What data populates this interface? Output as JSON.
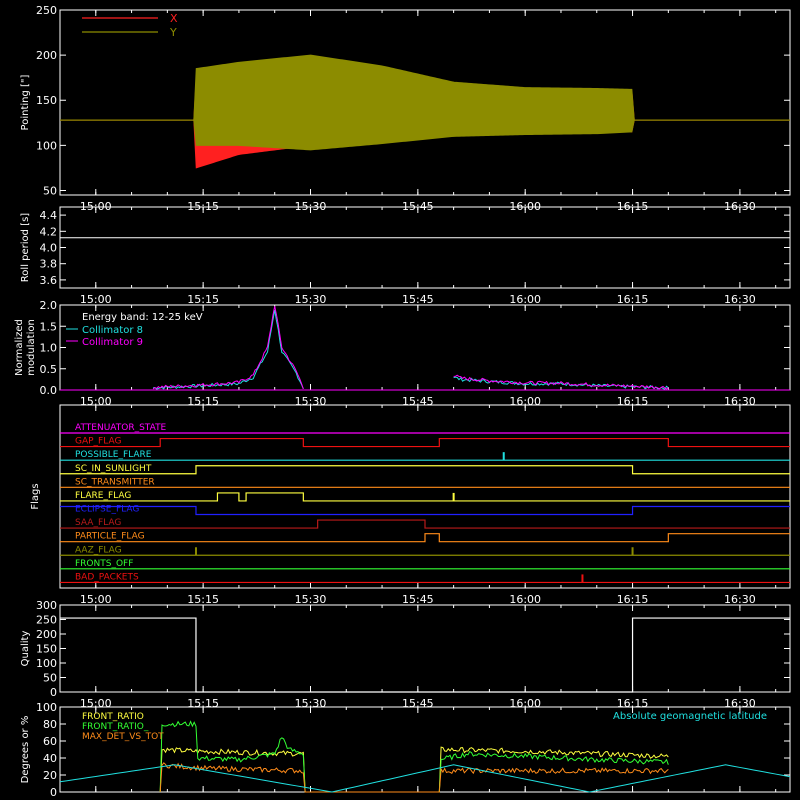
{
  "colors": {
    "background": "#000000",
    "axes": "#ffffff",
    "x": "#ff2020",
    "y": "#8c8c00",
    "cyan": "#20e0e0",
    "magenta": "#ff00ff",
    "green": "#22dd22",
    "yellow": "#ffff40",
    "orange": "#ff8c1a",
    "lime": "#33ff33",
    "blue": "#2020ff",
    "red": "#ee1111",
    "darkred": "#b81a1a",
    "olive": "#8c8c00"
  },
  "time_axis": {
    "range": [
      "14:55",
      "16:37"
    ],
    "ticks": [
      "15:00",
      "15:15",
      "15:30",
      "15:45",
      "16:00",
      "16:15",
      "16:30"
    ]
  },
  "chart_data": [
    {
      "id": "pointing",
      "type": "area",
      "ylabel": "Pointing [\"]",
      "ylim": [
        45,
        250
      ],
      "yticks": [
        50,
        100,
        150,
        200,
        250
      ],
      "baseline": 128,
      "series": [
        {
          "name": "X",
          "color": "#ff2020",
          "x": [
            "14:55",
            "15:14",
            "15:14",
            "15:20",
            "15:30",
            "15:40",
            "15:50",
            "16:00",
            "16:10",
            "16:15",
            "16:15",
            "16:37"
          ],
          "upper": [
            128,
            128,
            175,
            178,
            170,
            162,
            158,
            157,
            159,
            160,
            128,
            128
          ],
          "lower": [
            128,
            128,
            75,
            90,
            100,
            108,
            112,
            115,
            115,
            115,
            128,
            128
          ]
        },
        {
          "name": "Y",
          "color": "#8c8c00",
          "x": [
            "14:55",
            "15:14",
            "15:14",
            "15:20",
            "15:30",
            "15:40",
            "15:50",
            "16:00",
            "16:10",
            "16:15",
            "16:15",
            "16:37"
          ],
          "upper": [
            128,
            128,
            185,
            192,
            200,
            188,
            170,
            164,
            163,
            162,
            128,
            128
          ],
          "lower": [
            128,
            128,
            100,
            100,
            95,
            102,
            110,
            112,
            113,
            115,
            128,
            128
          ]
        }
      ]
    },
    {
      "id": "roll",
      "type": "line",
      "ylabel": "Roll period [s]",
      "ylim": [
        3.5,
        4.5
      ],
      "yticks": [
        3.6,
        3.8,
        4.0,
        4.2,
        4.4
      ],
      "series": [
        {
          "name": "",
          "x": [
            "14:55",
            "16:37"
          ],
          "y": [
            4.12,
            4.12
          ]
        }
      ]
    },
    {
      "id": "modulation",
      "type": "line",
      "ylabel": "Normalized modulation",
      "ylim": [
        0,
        2.0
      ],
      "yticks": [
        0.0,
        0.5,
        1.0,
        1.5,
        2.0
      ],
      "annotation": "Energy band: 12-25 keV",
      "series": [
        {
          "name": "Collimator 8",
          "color": "#20e0e0",
          "x": [
            "15:08",
            "15:15",
            "15:17",
            "15:20",
            "15:22",
            "15:24",
            "15:25",
            "15:26",
            "15:28",
            "15:29",
            "15:50",
            "15:51",
            "15:55",
            "16:00",
            "16:05",
            "16:10",
            "16:20"
          ],
          "y": [
            0.05,
            0.1,
            0.12,
            0.15,
            0.3,
            0.9,
            1.9,
            0.9,
            0.4,
            0.05,
            0.3,
            0.25,
            0.2,
            0.15,
            0.15,
            0.1,
            0.05
          ]
        },
        {
          "name": "Collimator 9",
          "color": "#ff00ff",
          "x": [
            "15:08",
            "15:15",
            "15:17",
            "15:20",
            "15:22",
            "15:24",
            "15:25",
            "15:26",
            "15:28",
            "15:29",
            "15:50",
            "15:51",
            "15:55",
            "16:00",
            "16:05",
            "16:10",
            "16:20"
          ],
          "y": [
            0.06,
            0.12,
            0.14,
            0.18,
            0.35,
            1.0,
            2.0,
            1.0,
            0.45,
            0.06,
            0.35,
            0.28,
            0.22,
            0.17,
            0.16,
            0.12,
            0.06
          ]
        }
      ]
    },
    {
      "id": "flags",
      "type": "line",
      "ylabel": "Flags",
      "series": [
        {
          "name": "ATTENUATOR_STATE",
          "color": "#ff00ff",
          "initial": 0,
          "transitions": []
        },
        {
          "name": "GAP_FLAG",
          "color": "#ee1111",
          "initial": 0,
          "transitions": [
            [
              "15:09",
              1
            ],
            [
              "15:29",
              0
            ],
            [
              "15:48",
              1
            ],
            [
              "16:20",
              0
            ]
          ]
        },
        {
          "name": "POSSIBLE_FLARE",
          "color": "#20e0e0",
          "initial": 0,
          "transitions": [],
          "spikes": [
            "15:57"
          ]
        },
        {
          "name": "SC_IN_SUNLIGHT",
          "color": "#ffff40",
          "initial": 0,
          "transitions": [
            [
              "15:14",
              1
            ],
            [
              "16:15",
              0
            ]
          ]
        },
        {
          "name": "SC_TRANSMITTER",
          "color": "#ff8c1a",
          "initial": 0,
          "transitions": []
        },
        {
          "name": "FLARE_FLAG",
          "color": "#ffff40",
          "initial": 0,
          "transitions": [
            [
              "15:17",
              1
            ],
            [
              "15:20",
              0
            ],
            [
              "15:21",
              1
            ],
            [
              "15:29",
              0
            ]
          ],
          "spikes": [
            "15:50"
          ]
        },
        {
          "name": "ECLIPSE_FLAG",
          "color": "#2020ff",
          "initial": 1,
          "transitions": [
            [
              "15:14",
              0
            ],
            [
              "16:15",
              1
            ]
          ]
        },
        {
          "name": "SAA_FLAG",
          "color": "#b81a1a",
          "initial": 0,
          "transitions": [
            [
              "15:31",
              1
            ],
            [
              "15:46",
              0
            ]
          ]
        },
        {
          "name": "PARTICLE_FLAG",
          "color": "#ff8c1a",
          "initial": 0,
          "transitions": [
            [
              "15:46",
              1
            ],
            [
              "15:48",
              0
            ],
            [
              "16:20",
              1
            ]
          ]
        },
        {
          "name": "AAZ_FLAG",
          "color": "#8c8c00",
          "initial": 0,
          "transitions": [],
          "spikes": [
            "15:14",
            "16:15"
          ]
        },
        {
          "name": "FRONTS_OFF",
          "color": "#33ff33",
          "initial": 0,
          "transitions": []
        },
        {
          "name": "BAD_PACKETS",
          "color": "#ee1111",
          "initial": 0,
          "transitions": [],
          "spikes": [
            "16:08"
          ]
        }
      ]
    },
    {
      "id": "quality",
      "type": "line",
      "ylabel": "Quality",
      "ylim": [
        0,
        300
      ],
      "yticks": [
        0,
        50,
        100,
        150,
        200,
        250,
        300
      ],
      "series": [
        {
          "name": "",
          "x": [
            "14:55",
            "15:14",
            "15:14",
            "16:15",
            "16:15",
            "16:37"
          ],
          "y": [
            255,
            255,
            0,
            0,
            255,
            255
          ]
        }
      ]
    },
    {
      "id": "ratios",
      "type": "line",
      "ylabel": "Degrees or %",
      "ylim": [
        0,
        100
      ],
      "yticks": [
        0,
        20,
        40,
        60,
        80,
        100
      ],
      "series": [
        {
          "name": "FRONT_RATIO",
          "color": "#ffff40",
          "x": [
            "15:09",
            "15:09",
            "15:14",
            "15:29",
            "15:29",
            "15:48",
            "15:48",
            "16:00",
            "16:20",
            "16:20"
          ],
          "y": [
            0,
            50,
            48,
            45,
            0,
            0,
            50,
            48,
            42,
            0
          ]
        },
        {
          "name": "FRONT_RATIO_",
          "color": "#33ff33",
          "x": [
            "15:09",
            "15:09",
            "15:14",
            "15:14",
            "15:20",
            "15:25",
            "15:26",
            "15:27",
            "15:29",
            "15:29",
            "15:48",
            "15:48",
            "15:52",
            "16:00",
            "16:10",
            "16:20",
            "16:20"
          ],
          "y": [
            0,
            80,
            80,
            40,
            38,
            45,
            65,
            50,
            45,
            0,
            0,
            38,
            45,
            42,
            38,
            35,
            0
          ]
        },
        {
          "name": "MAX_DET_VS_TOT",
          "color": "#ff8c1a",
          "x": [
            "15:09",
            "15:09",
            "15:15",
            "15:29",
            "15:29",
            "15:48",
            "15:48",
            "16:20",
            "16:20"
          ],
          "y": [
            0,
            32,
            28,
            25,
            0,
            0,
            25,
            25,
            0
          ]
        },
        {
          "name": "Absolute geomagnetic latitude",
          "color": "#20e0e0",
          "x": [
            "14:55",
            "15:11",
            "15:33",
            "15:50",
            "16:09",
            "16:28",
            "16:37"
          ],
          "y": [
            12,
            32,
            0,
            32,
            0,
            32,
            18
          ]
        }
      ]
    }
  ]
}
